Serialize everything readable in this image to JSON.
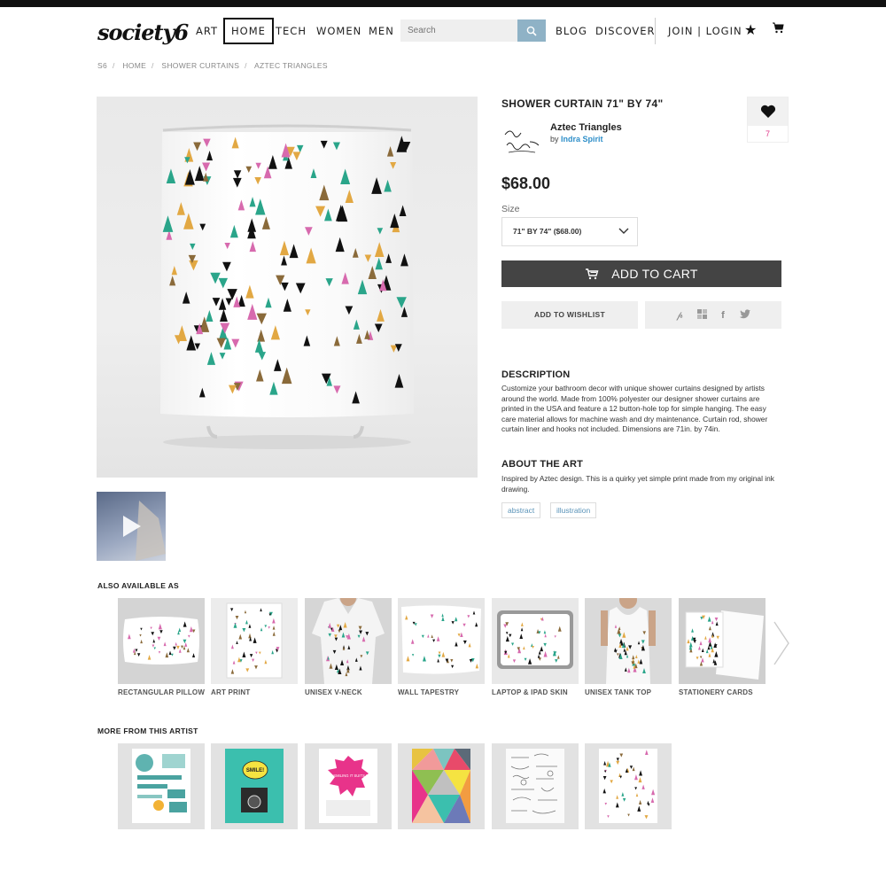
{
  "header": {
    "logo": "society6",
    "nav": {
      "art": "ART",
      "home": "HOME",
      "tech": "TECH",
      "women": "WOMEN",
      "men": "MEN",
      "blog": "BLOG",
      "discover": "DISCOVER",
      "join_login": "JOIN | LOGIN"
    },
    "search_placeholder": "Search"
  },
  "breadcrumb": [
    "S6",
    "HOME",
    "SHOWER CURTAINS",
    "AZTEC TRIANGLES"
  ],
  "product": {
    "title": "SHOWER CURTAIN 71\" BY 74\"",
    "artwork_name": "Aztec Triangles",
    "by_prefix": "by",
    "artist": "Indra Spirit",
    "likes": "7",
    "price": "$68.00",
    "size_label": "Size",
    "size_value": "71\" BY 74\" ($68.00)",
    "add_to_cart": "ADD TO CART",
    "add_to_wishlist": "ADD TO WISHLIST"
  },
  "description": {
    "title": "DESCRIPTION",
    "body": "Customize your bathroom decor with unique shower curtains designed by artists around the world. Made from 100% polyester our designer shower curtains are printed in the USA and feature a 12 button-hole top for simple hanging. The easy care material allows for machine wash and dry maintenance. Curtain rod, shower curtain liner and hooks not included. Dimensions are 71in. by 74in."
  },
  "about": {
    "title": "ABOUT THE ART",
    "body": "Inspired by Aztec design. This is a quirky yet simple print made from my original ink drawing."
  },
  "tags": [
    "abstract",
    "illustration"
  ],
  "also_available": {
    "title": "ALSO AVAILABLE AS",
    "items": [
      "RECTANGULAR PILLOW",
      "ART PRINT",
      "UNISEX V-NECK",
      "WALL TAPESTRY",
      "LAPTOP & IPAD SKIN",
      "UNISEX TANK TOP",
      "STATIONERY CARDS"
    ]
  },
  "more_from_artist": {
    "title": "MORE FROM THIS ARTIST",
    "texts": {
      "smile": "SMILE!",
      "keep_smiling": "KEEP SMILING IT SUITS YOU"
    }
  },
  "colors": {
    "teal": "#2aa58a",
    "gold": "#e2a843",
    "pink": "#d76aae",
    "black": "#111111",
    "brown": "#8a6a3a",
    "cart": "#444444",
    "link": "#2f8fc9",
    "like": "#e0398a",
    "search_button": "#8fb2c6"
  },
  "icons": [
    "search-icon",
    "star-icon",
    "cart-icon",
    "heart-icon",
    "chevron-down-icon",
    "play-icon",
    "pinterest-icon",
    "tumblr-icon",
    "facebook-icon",
    "twitter-icon",
    "chevron-right-icon"
  ]
}
